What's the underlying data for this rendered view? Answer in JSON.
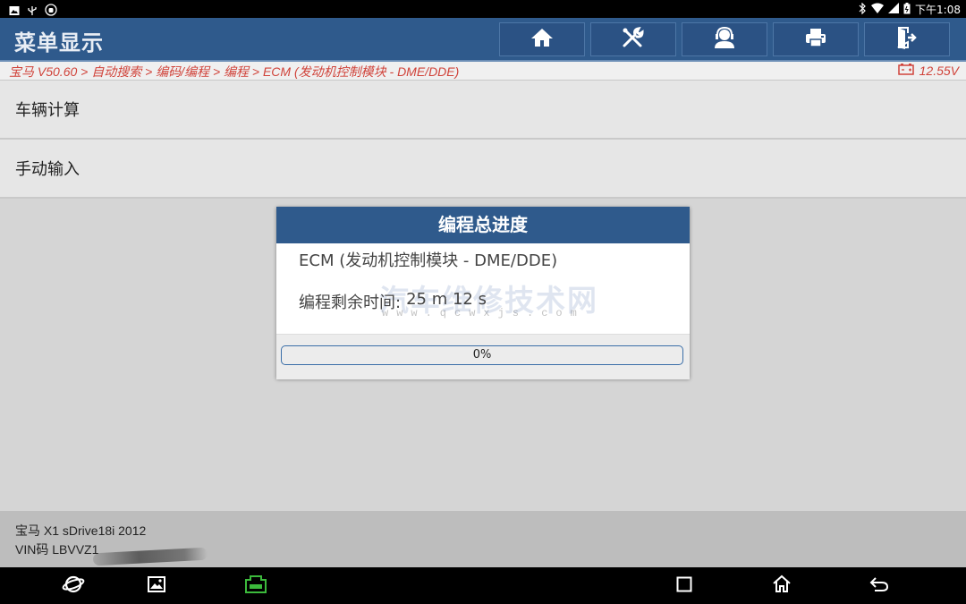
{
  "status_bar": {
    "time": "下午1:08",
    "left_icons": [
      "image-icon",
      "usb-icon",
      "android-debug-icon"
    ],
    "right_icons": [
      "bluetooth-icon",
      "wifi-icon",
      "signal-icon",
      "battery-icon"
    ]
  },
  "header": {
    "title": "菜单显示",
    "toolbar": [
      {
        "name": "home-icon"
      },
      {
        "name": "diagnostic-tools-icon"
      },
      {
        "name": "user-support-icon"
      },
      {
        "name": "print-icon"
      },
      {
        "name": "exit-icon"
      }
    ]
  },
  "breadcrumb": {
    "path": "宝马 V50.60 > 自动搜索 > 编码/编程 > 编程 > ECM (发动机控制模块 - DME/DDE)",
    "voltage": "12.55V",
    "accent": "#d0433a"
  },
  "menu": {
    "items": [
      {
        "label": "车辆计算"
      },
      {
        "label": "手动输入"
      }
    ]
  },
  "dialog": {
    "title": "编程总进度",
    "module": "ECM (发动机控制模块 - DME/DDE)",
    "remaining_label": "编程剩余时间:",
    "remaining_value": "25 m 12 s",
    "progress": {
      "value": 0,
      "text": "0%"
    },
    "watermark": "汽车维修技术网",
    "watermark_url": "www.qcwxjs.com"
  },
  "vehicle": {
    "model": "宝马 X1 sDrive18i 2012",
    "vin": "VIN码 LBVVZ1"
  },
  "navbar": {
    "buttons": [
      "browser-icon",
      "gallery-icon",
      "vci-icon",
      "recents-icon",
      "home-nav-icon",
      "back-icon"
    ]
  },
  "colors": {
    "header_bg": "#2f5a8c",
    "progress": "#3a6ea8",
    "vci": "#3cba3c"
  }
}
